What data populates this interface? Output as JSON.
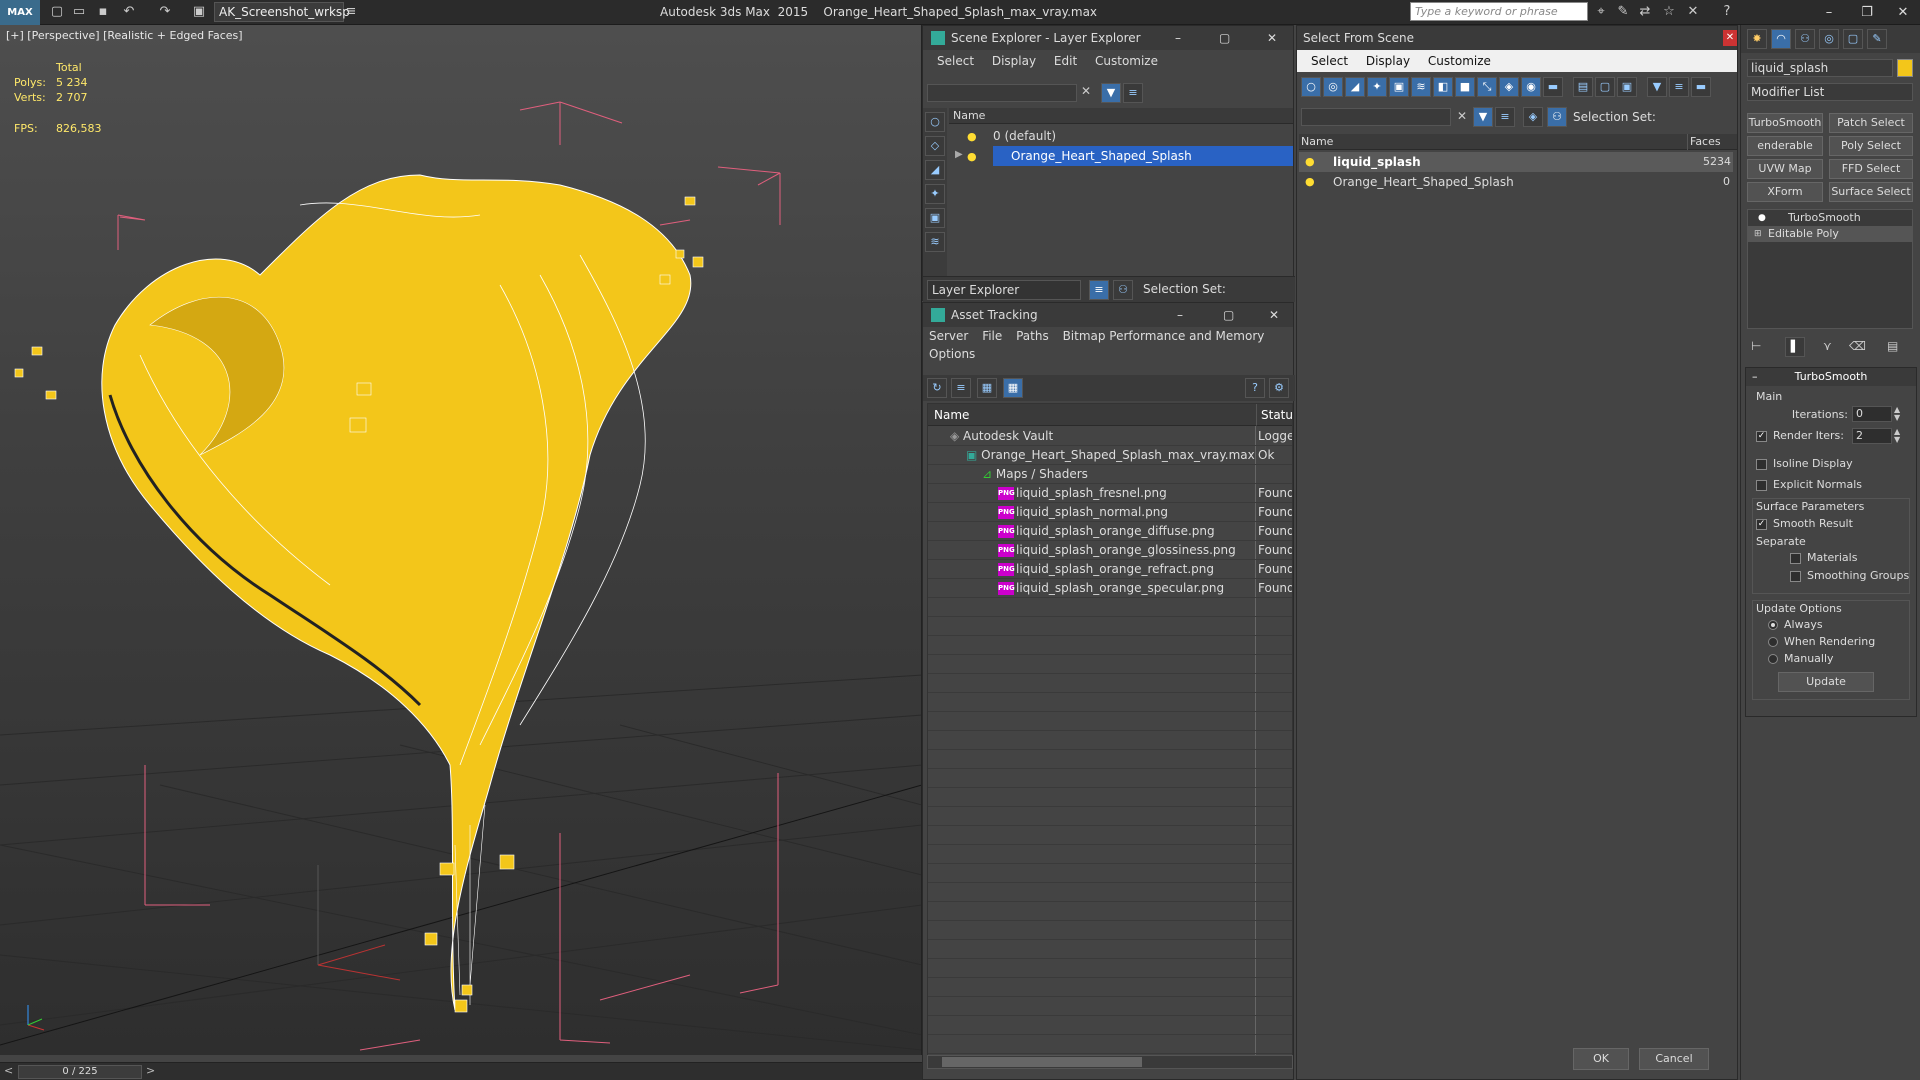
{
  "app": {
    "logo": "MAX",
    "workspace": "AK_Screenshot_wrksp",
    "title": "Autodesk 3ds Max  2015    Orange_Heart_Shaped_Splash_max_vray.max",
    "search_placeholder": "Type a keyword or phrase"
  },
  "viewport": {
    "label": "[+] [Perspective] [Realistic + Edged Faces]",
    "stats_header": "Total",
    "polys_label": "Polys:",
    "polys_value": "5 234",
    "verts_label": "Verts:",
    "verts_value": "2 707",
    "fps_label": "FPS:",
    "fps_value": "826,583",
    "frame_counter": "0 / 225",
    "colors": {
      "object": "#f3c61a",
      "wire": "#ffffff",
      "bbox": "#e05f7d"
    }
  },
  "scene_explorer": {
    "title": "Scene Explorer - Layer Explorer",
    "menu": [
      "Select",
      "Display",
      "Edit",
      "Customize"
    ],
    "column_name": "Name",
    "layers": [
      "0 (default)",
      "Orange_Heart_Shaped_Splash"
    ],
    "footer_mode": "Layer Explorer",
    "footer_selection": "Selection Set:"
  },
  "asset_tracking": {
    "title": "Asset Tracking",
    "menu": [
      "Server",
      "File",
      "Paths",
      "Bitmap Performance and Memory"
    ],
    "menu2": "Options",
    "col_name": "Name",
    "col_status": "Status",
    "rows": [
      {
        "name": "Autodesk Vault",
        "status": "Logged"
      },
      {
        "name": "Orange_Heart_Shaped_Splash_max_vray.max",
        "status": "Ok"
      },
      {
        "name": "Maps / Shaders",
        "status": ""
      },
      {
        "name": "liquid_splash_fresnel.png",
        "status": "Found"
      },
      {
        "name": "liquid_splash_normal.png",
        "status": "Found"
      },
      {
        "name": "liquid_splash_orange_diffuse.png",
        "status": "Found"
      },
      {
        "name": "liquid_splash_orange_glossiness.png",
        "status": "Found"
      },
      {
        "name": "liquid_splash_orange_refract.png",
        "status": "Found"
      },
      {
        "name": "liquid_splash_orange_specular.png",
        "status": "Found"
      }
    ]
  },
  "select_from_scene": {
    "title": "Select From Scene",
    "menu": [
      "Select",
      "Display",
      "Customize"
    ],
    "selection_set": "Selection Set:",
    "col_name": "Name",
    "col_faces": "Faces",
    "rows": [
      {
        "name": "liquid_splash",
        "faces": "5234"
      },
      {
        "name": "Orange_Heart_Shaped_Splash",
        "faces": "0"
      }
    ],
    "ok": "OK",
    "cancel": "Cancel"
  },
  "command_panel": {
    "object_name": "liquid_splash",
    "modifier_list": "Modifier List",
    "buttons": [
      "TurboSmooth",
      "Patch Select",
      "enderable Spli",
      "Poly Select",
      "UVW Map",
      "FFD Select",
      "XForm",
      "Surface Select"
    ],
    "stack": [
      "TurboSmooth",
      "Editable Poly"
    ],
    "rollout_title": "TurboSmooth",
    "main": "Main",
    "iterations_label": "Iterations:",
    "iterations_value": "0",
    "render_iters_label": "Render Iters:",
    "render_iters_value": "2",
    "isoline": "Isoline Display",
    "explicit_normals": "Explicit Normals",
    "surface_params": "Surface Parameters",
    "smooth_result": "Smooth Result",
    "separate": "Separate",
    "materials": "Materials",
    "smoothing_groups": "Smoothing Groups",
    "update_options": "Update Options",
    "always": "Always",
    "when_rendering": "When Rendering",
    "manually": "Manually",
    "update": "Update"
  }
}
